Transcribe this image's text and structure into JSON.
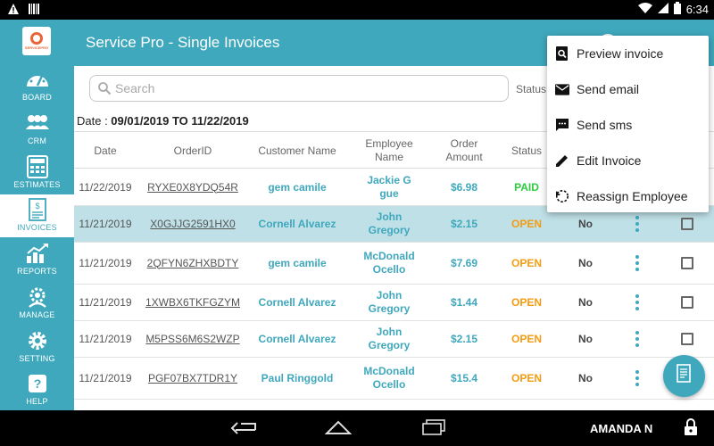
{
  "status_bar": {
    "time": "6:34",
    "icons": [
      "warning-icon",
      "barcode-icon",
      "wifi-icon",
      "signal-icon",
      "battery-icon"
    ]
  },
  "sidebar": {
    "logo_text": "SERVICEPRO",
    "items": [
      {
        "label": "BOARD",
        "icon": "dashboard-icon",
        "active": false
      },
      {
        "label": "CRM",
        "icon": "people-icon",
        "active": false
      },
      {
        "label": "ESTIMATES",
        "icon": "calculator-icon",
        "active": false
      },
      {
        "label": "INVOICES",
        "icon": "invoice-icon",
        "active": true
      },
      {
        "label": "REPORTS",
        "icon": "chart-icon",
        "active": false
      },
      {
        "label": "MANAGE",
        "icon": "manage-gear-icon",
        "active": false
      },
      {
        "label": "SETTING",
        "icon": "gear-icon",
        "active": false
      },
      {
        "label": "HELP",
        "icon": "help-icon",
        "active": false
      }
    ]
  },
  "header": {
    "title": "Service Pro - Single Invoices"
  },
  "search": {
    "placeholder": "Search",
    "value": ""
  },
  "status_filter_label": "Status",
  "date_range": {
    "label": "Date : ",
    "value": "09/01/2019 TO 11/22/2019"
  },
  "table": {
    "headers": {
      "date": "Date",
      "order_id": "OrderID",
      "customer": "Customer Name",
      "employee": "Employee Name",
      "amount": "Order Amount",
      "status": "Status"
    },
    "rows": [
      {
        "date": "11/22/2019",
        "order_id": "RYXE0X8YDQ54R",
        "customer": "gem camile",
        "employee": "Jackie G gue",
        "amount": "$6.98",
        "status": "PAID",
        "flag": "",
        "selected": false
      },
      {
        "date": "11/21/2019",
        "order_id": "X0GJJG2591HX0",
        "customer": "Cornell Alvarez",
        "employee": "John Gregory",
        "amount": "$2.15",
        "status": "OPEN",
        "flag": "No",
        "selected": true
      },
      {
        "date": "11/21/2019",
        "order_id": "2QFYN6ZHXBDTY",
        "customer": "gem camile",
        "employee": "McDonald Ocello",
        "amount": "$7.69",
        "status": "OPEN",
        "flag": "No",
        "selected": false
      },
      {
        "date": "11/21/2019",
        "order_id": "1XWBX6TKFGZYM",
        "customer": "Cornell Alvarez",
        "employee": "John Gregory",
        "amount": "$1.44",
        "status": "OPEN",
        "flag": "No",
        "selected": false
      },
      {
        "date": "11/21/2019",
        "order_id": "M5PSS6M6S2WZP",
        "customer": "Cornell Alvarez",
        "employee": "John Gregory",
        "amount": "$2.15",
        "status": "OPEN",
        "flag": "No",
        "selected": false
      },
      {
        "date": "11/21/2019",
        "order_id": "PGF07BX7TDR1Y",
        "customer": "Paul Ringgold",
        "employee": "McDonald Ocello",
        "amount": "$15.4",
        "status": "OPEN",
        "flag": "No",
        "selected": false
      }
    ]
  },
  "context_menu": {
    "items": [
      {
        "label": "Preview invoice",
        "icon": "preview-icon"
      },
      {
        "label": "Send email",
        "icon": "email-icon"
      },
      {
        "label": "Send sms",
        "icon": "sms-icon"
      },
      {
        "label": "Edit Invoice",
        "icon": "edit-icon"
      },
      {
        "label": "Reassign Employee",
        "icon": "reassign-icon"
      }
    ]
  },
  "fab_icon": "new-invoice-icon",
  "nav_bar": {
    "user": "AMANDA N",
    "icons": [
      "back-icon",
      "home-icon",
      "recent-apps-icon",
      "lock-icon"
    ]
  },
  "colors": {
    "primary": "#3fa8bd",
    "selected_row": "#bfe0e7",
    "open_status": "#f39c12",
    "paid_status": "#2ecc40"
  }
}
